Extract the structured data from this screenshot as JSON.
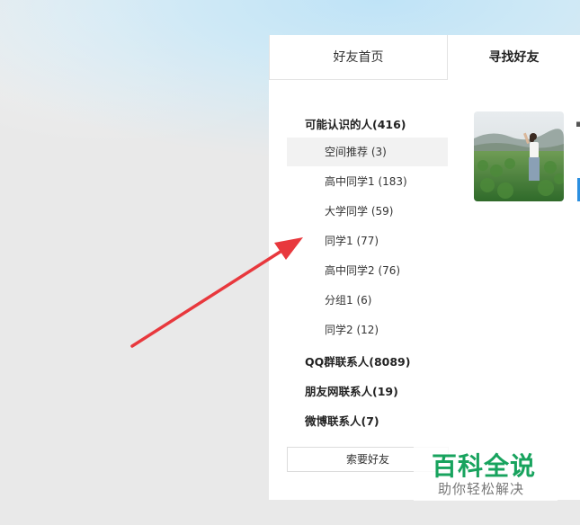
{
  "tabs": {
    "home_label": "好友首页",
    "find_label": "寻找好友"
  },
  "groups": {
    "maybe_known": "可能认识的人(416)",
    "qq_group": "QQ群联系人(8089)",
    "pengyou": "朋友网联系人(19)",
    "weibo": "微博联系人(7)"
  },
  "sub_items": [
    {
      "label": "空间推荐 (3)",
      "active": true
    },
    {
      "label": "高中同学1 (183)",
      "active": false
    },
    {
      "label": "大学同学 (59)",
      "active": false
    },
    {
      "label": "同学1 (77)",
      "active": false
    },
    {
      "label": "高中同学2 (76)",
      "active": false
    },
    {
      "label": "分组1 (6)",
      "active": false
    },
    {
      "label": "同学2 (12)",
      "active": false
    }
  ],
  "request_button_label": "索要好友",
  "watermark": {
    "title": "百科全说",
    "subtitle": "助你轻松解决"
  },
  "colors": {
    "arrow": "#e8383d",
    "watermark_green": "#18a35e",
    "accent_blue": "#2b8fe0"
  }
}
